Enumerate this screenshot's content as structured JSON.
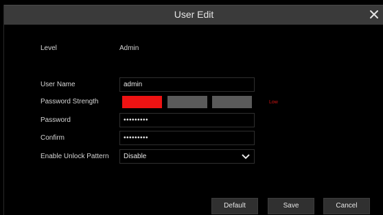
{
  "dialog": {
    "title": "User Edit"
  },
  "form": {
    "level_label": "Level",
    "level_value": "Admin",
    "username_label": "User Name",
    "username_value": "admin",
    "strength_label": "Password Strength",
    "strength_text": "Low",
    "strength_colors": [
      "#ee1313",
      "#5a5a5a",
      "#5a5a5a"
    ],
    "password_label": "Password",
    "password_value": "•••••••••",
    "confirm_label": "Confirm",
    "confirm_value": "•••••••••",
    "unlock_label": "Enable Unlock Pattern",
    "unlock_value": "Disable"
  },
  "buttons": {
    "default_label": "Default",
    "save_label": "Save",
    "cancel_label": "Cancel"
  },
  "icons": {
    "close": "close-icon",
    "dropdown": "chevron-down-icon"
  }
}
